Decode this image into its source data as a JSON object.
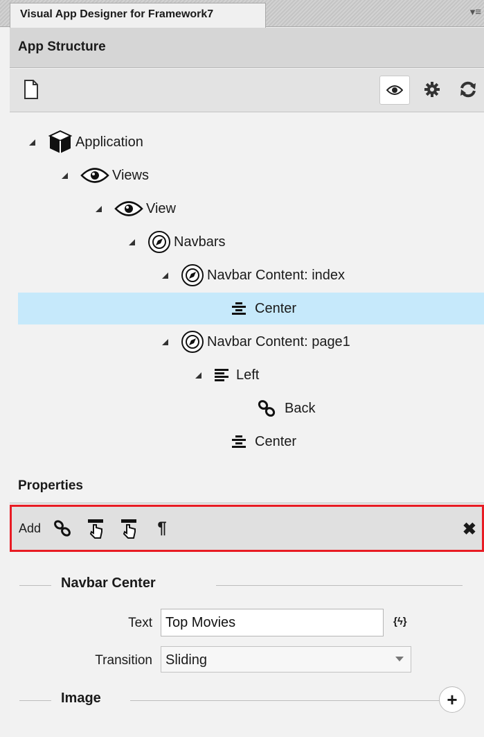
{
  "window": {
    "tab_title": "Visual App Designer for Framework7"
  },
  "structure": {
    "title": "App Structure",
    "toolbar": {
      "new_icon": "new-document-icon",
      "view_icon": "eye-icon",
      "settings_icon": "gear-icon",
      "refresh_icon": "refresh-icon"
    },
    "tree": [
      {
        "label": "Application",
        "icon": "cube-icon",
        "expanded": true
      },
      {
        "label": "Views",
        "icon": "eye-icon",
        "expanded": true
      },
      {
        "label": "View",
        "icon": "eye-icon",
        "expanded": true
      },
      {
        "label": "Navbars",
        "icon": "compass-icon",
        "expanded": true
      },
      {
        "label": "Navbar Content: index",
        "icon": "compass-icon",
        "expanded": true
      },
      {
        "label": "Center",
        "icon": "align-center-icon",
        "selected": true
      },
      {
        "label": "Navbar Content: page1",
        "icon": "compass-icon",
        "expanded": true
      },
      {
        "label": "Left",
        "icon": "align-left-icon",
        "expanded": true
      },
      {
        "label": "Back",
        "icon": "link-icon"
      },
      {
        "label": "Center",
        "icon": "align-center-icon"
      }
    ]
  },
  "properties": {
    "title": "Properties",
    "toolbar": {
      "add_label": "Add",
      "icons": [
        "link-icon",
        "touch-icon",
        "touch-icon",
        "paragraph-icon"
      ],
      "close_icon": "close-icon"
    },
    "group_title": "Navbar Center",
    "text_label": "Text",
    "text_value": "Top Movies",
    "expr_label": "{ϟ}",
    "transition_label": "Transition",
    "transition_value": "Sliding",
    "image_group_title": "Image"
  },
  "colors": {
    "selection": "#c6e9fb",
    "highlight_border": "#e81b23"
  }
}
